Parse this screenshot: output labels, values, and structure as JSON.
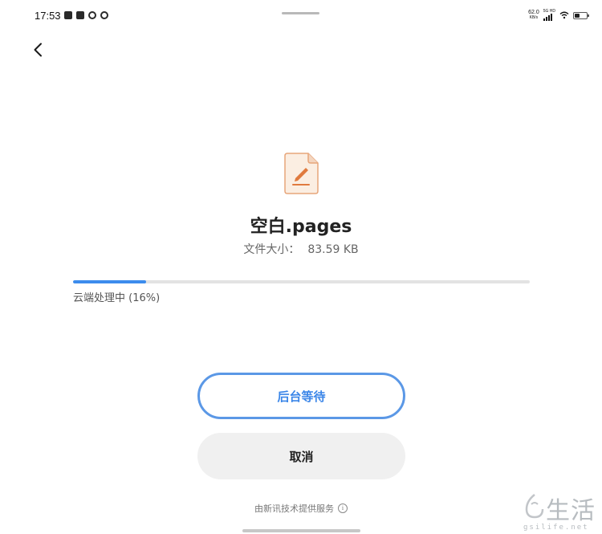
{
  "status_bar": {
    "time": "17:53",
    "net_speed_value": "62.0",
    "net_speed_unit": "KB/s",
    "network_type": "5G HD",
    "icons": [
      "gallery-icon",
      "tick-icon",
      "instagram-icon",
      "link-icon",
      "signal-icon",
      "wifi-icon",
      "battery-icon"
    ]
  },
  "file": {
    "name": "空白.pages",
    "size_label": "文件大小：",
    "size_value": "83.59 KB",
    "icon": "document-edit-icon",
    "icon_color": "#e07a3e"
  },
  "progress": {
    "label": "云端处理中 (16%)",
    "value_percent": 16,
    "color": "#3c8ced"
  },
  "actions": {
    "wait_label": "后台等待",
    "cancel_label": "取消"
  },
  "footer": {
    "provider_text": "由新讯技术提供服务",
    "info_icon": "ⓘ"
  },
  "watermark": {
    "text": "生活",
    "url": "gsilife.net"
  },
  "colors": {
    "accent": "#3b86e8",
    "button_border": "#5b98e6",
    "cancel_bg": "#f0f0f0"
  }
}
